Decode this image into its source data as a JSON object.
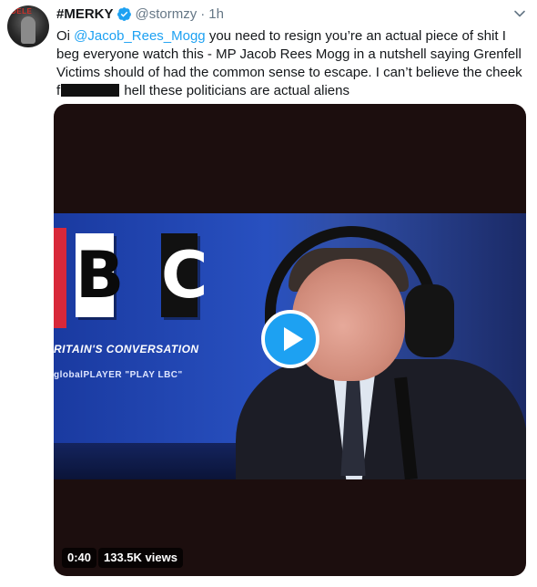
{
  "tweet": {
    "display_name": "#MERKY",
    "handle": "@stormzy",
    "separator": "·",
    "time": "1h",
    "avatar_badge": "DELE",
    "text": {
      "part1": "Oi ",
      "mention": "@Jacob_Rees_Mogg",
      "part2": " you need to resign you’re an actual piece of shit I beg everyone watch this - MP Jacob Rees Mogg in a nutshell saying Grenfell Victims should of had the common sense to escape. I can’t believe the cheek f",
      "part3": " hell these politicians are actual aliens"
    }
  },
  "video": {
    "duration": "0:40",
    "views": "133.5K views",
    "frame_tiles": [
      "B",
      "C"
    ],
    "frame_slogan": "RITAIN'S CONVERSATION",
    "frame_players": "globalPLAYER   \"PLAY LBC\""
  },
  "colors": {
    "link": "#1da1f2",
    "play_button": "#1da1f2",
    "muted_text": "#657786"
  }
}
